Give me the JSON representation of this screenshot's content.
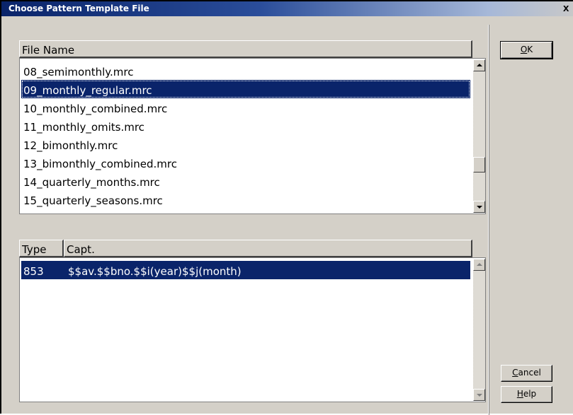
{
  "window": {
    "title": "Choose Pattern Template File",
    "close_glyph": "x"
  },
  "files": {
    "header": "File Name",
    "items": [
      "08_semimonthly.mrc",
      "09_monthly_regular.mrc",
      "10_monthly_combined.mrc",
      "11_monthly_omits.mrc",
      "12_bimonthly.mrc",
      "13_bimonthly_combined.mrc",
      "14_quarterly_months.mrc",
      "15_quarterly_seasons.mrc"
    ],
    "selected": "09_monthly_regular.mrc"
  },
  "details": {
    "headers": {
      "type": "Type",
      "capt": "Capt."
    },
    "rows": [
      {
        "type": "853",
        "capt": "$$av.$$bno.$$i(year)$$j(month)"
      }
    ]
  },
  "buttons": {
    "ok": {
      "mnemonic": "O",
      "rest": "K"
    },
    "cancel": {
      "mnemonic": "C",
      "rest": "ancel"
    },
    "help": {
      "mnemonic": "H",
      "rest": "elp"
    }
  },
  "icons": {
    "close": "close-icon",
    "scroll_up": "arrow-up-icon",
    "scroll_down": "arrow-down-icon"
  }
}
